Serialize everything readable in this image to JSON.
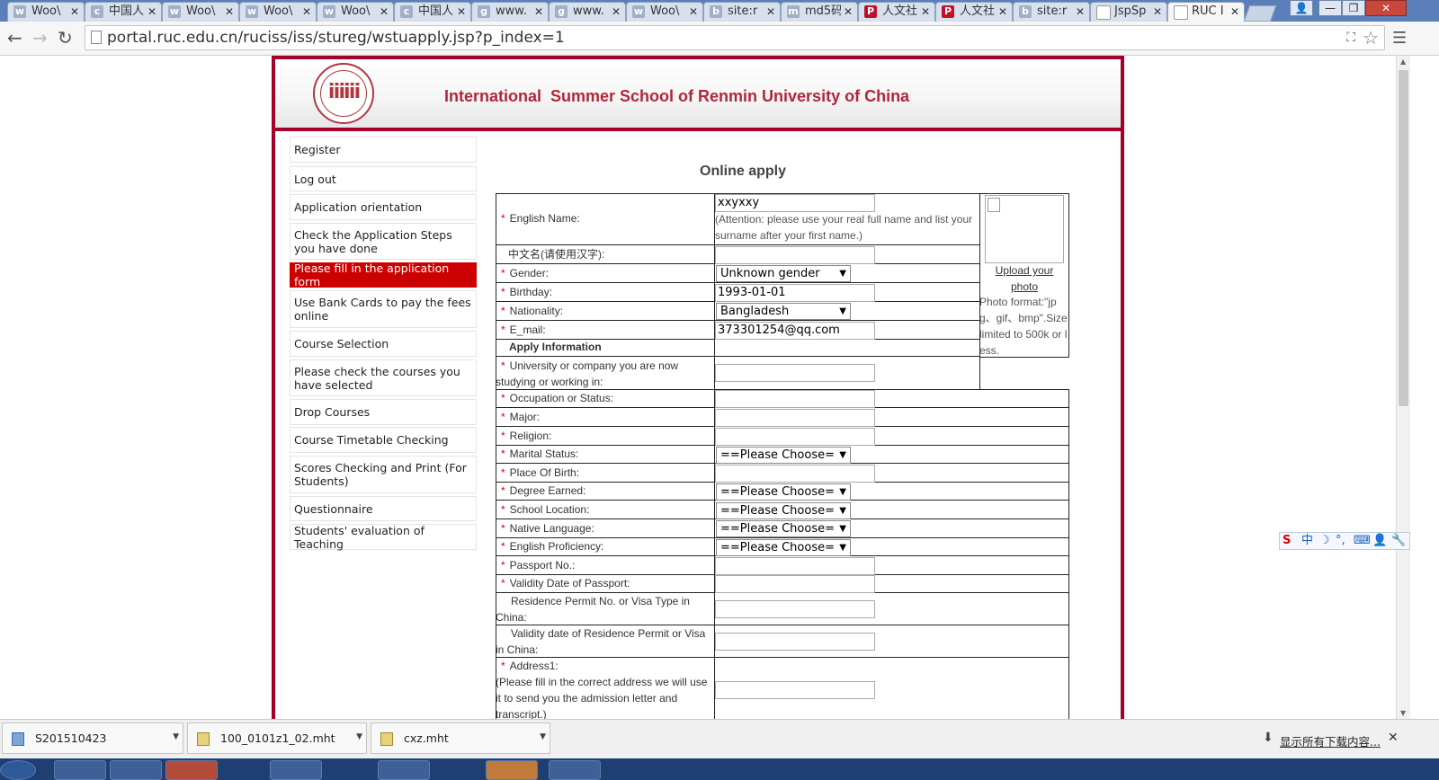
{
  "browser": {
    "tabs": [
      {
        "title": "Woo\\",
        "icon": "w"
      },
      {
        "title": "中国人",
        "icon": "c"
      },
      {
        "title": "Woo\\",
        "icon": "w"
      },
      {
        "title": "Woo\\",
        "icon": "w"
      },
      {
        "title": "Woo\\",
        "icon": "w"
      },
      {
        "title": "中国人",
        "icon": "c"
      },
      {
        "title": "www.",
        "icon": "g"
      },
      {
        "title": "www.",
        "icon": "g"
      },
      {
        "title": "Woo\\",
        "icon": "w"
      },
      {
        "title": "site:r",
        "icon": "b"
      },
      {
        "title": "md5码",
        "icon": "m"
      },
      {
        "title": "人文社",
        "icon": "P"
      },
      {
        "title": "人文社",
        "icon": "P"
      },
      {
        "title": "site:r",
        "icon": "b"
      },
      {
        "title": "JspSp",
        "icon": "d"
      },
      {
        "title": "RUC I",
        "icon": "d"
      }
    ],
    "url": "portal.ruc.edu.cn/ruciss/iss/stureg/wstuapply.jsp?p_index=1"
  },
  "header": {
    "title": "International  Summer School of Renmin University of China"
  },
  "sidebar": {
    "items": [
      {
        "label": "Register"
      },
      {
        "label": "Log out"
      },
      {
        "label": "Application orientation"
      },
      {
        "label": "Check the Application Steps you have done"
      },
      {
        "label": "Please fill in the application form"
      },
      {
        "label": "Use Bank Cards to pay the fees online"
      },
      {
        "label": "Course Selection"
      },
      {
        "label": "Please check the courses you have selected"
      },
      {
        "label": "Drop Courses"
      },
      {
        "label": "Course Timetable Checking"
      },
      {
        "label": "Scores Checking and Print (For Students)"
      },
      {
        "label": "Questionnaire"
      },
      {
        "label": "Students' evaluation of Teaching"
      }
    ]
  },
  "form": {
    "title": "Online apply",
    "english_name": {
      "label": "English Name:",
      "value": "xxyxxy",
      "note": "(Attention: please use your real full name and list your surname after your first name.)"
    },
    "chinese_name": {
      "label": "中文名(请使用汉字):",
      "value": ""
    },
    "gender": {
      "label": "Gender:",
      "value": "Unknown gender"
    },
    "birthday": {
      "label": "Birthday:",
      "value": "1993-01-01"
    },
    "nationality": {
      "label": "Nationality:",
      "value": "Bangladesh"
    },
    "email": {
      "label": "E_mail:",
      "value": "373301254@qq.com"
    },
    "photo": {
      "upload_label": "Upload your photo",
      "note": "Photo format:\"jpg、gif、bmp\".Size limited to 500k or less."
    },
    "apply_section": "Apply Information",
    "university": {
      "label": "University or company you are now studying or working in:"
    },
    "occupation": {
      "label": "Occupation or Status:"
    },
    "major": {
      "label": "Major:"
    },
    "religion": {
      "label": "Religion:"
    },
    "marital_status": {
      "label": "Marital Status:",
      "value": "==Please Choose="
    },
    "place_of_birth": {
      "label": "Place Of Birth:"
    },
    "degree": {
      "label": "Degree Earned:",
      "value": "==Please Choose="
    },
    "school_location": {
      "label": "School Location:",
      "value": "==Please Choose="
    },
    "native_language": {
      "label": "Native Language:",
      "value": "==Please Choose="
    },
    "english_proficiency": {
      "label": "English Proficiency:",
      "value": "==Please Choose="
    },
    "passport_no": {
      "label": "Passport No.:"
    },
    "passport_validity": {
      "label": "Validity Date of Passport:"
    },
    "residence_permit": {
      "label": "Residence Permit No. or Visa Type in China:"
    },
    "residence_validity": {
      "label": "Validity date of Residence Permit or Visa in China:"
    },
    "address1": {
      "label": "Address1:",
      "note": "(Please fill in the correct address we will use it to send you the admission letter and transcript.)"
    },
    "required_mark": "*"
  },
  "downloads": {
    "items": [
      {
        "name": "S201510423"
      },
      {
        "name": "100_0101z1_02.mht"
      },
      {
        "name": "cxz.mht"
      }
    ],
    "show_all": "显示所有下载内容..."
  },
  "ime": {
    "items": [
      "S",
      "中",
      "☽",
      "°,",
      "⌨",
      "👤",
      "🔧"
    ]
  },
  "colors": {
    "brand": "#a5002a",
    "active_nav": "#cc0000",
    "required": "#dd0000"
  }
}
